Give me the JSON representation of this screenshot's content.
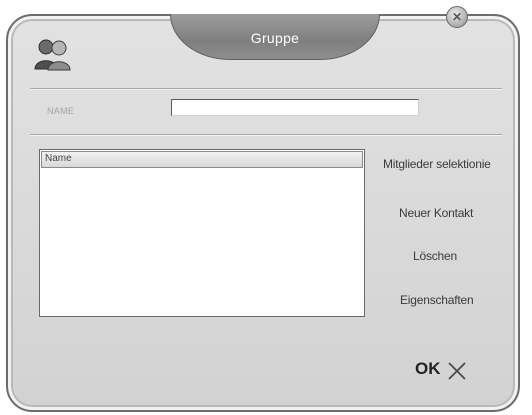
{
  "dialog": {
    "title": "Gruppe",
    "name_label": "NAME",
    "name_value": "",
    "list_header": "Name",
    "members": [],
    "actions": {
      "select_members": "Mitglieder selektionie",
      "new_contact": "Neuer Kontakt",
      "delete": "Löschen",
      "properties": "Eigenschaften"
    },
    "ok_label": "OK",
    "icons": {
      "close": "close-icon",
      "group": "group-icon",
      "cancel": "x-icon"
    }
  }
}
